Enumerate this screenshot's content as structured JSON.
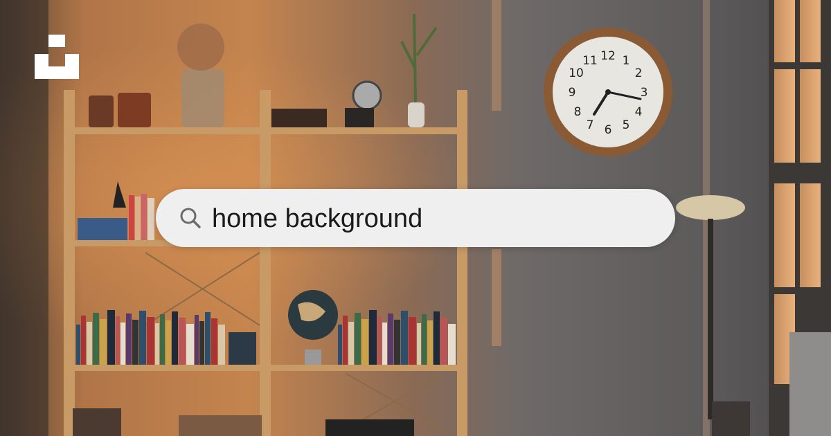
{
  "search": {
    "query": "home background"
  },
  "clock": {
    "numbers": [
      "12",
      "1",
      "2",
      "3",
      "4",
      "5",
      "6",
      "7",
      "8",
      "9",
      "10",
      "11"
    ]
  },
  "icons": {
    "logo": "unsplash-logo-icon",
    "search": "search-icon"
  }
}
